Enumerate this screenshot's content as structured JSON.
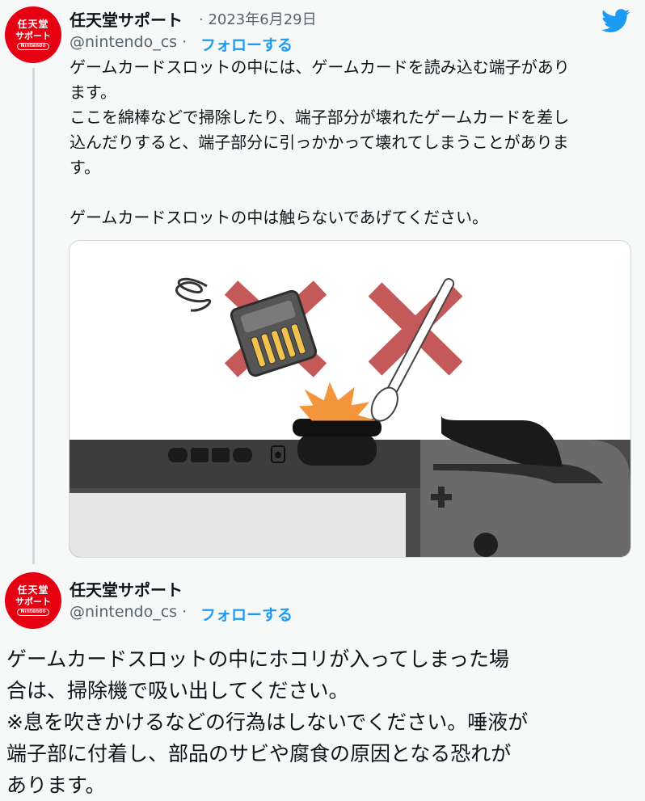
{
  "tweet1": {
    "avatar": {
      "line1": "任天堂",
      "line2": "サポート",
      "line3": "Nintendo"
    },
    "name": "任天堂サポート",
    "date": "· 2023年6月29日",
    "handle": "@nintendo_cs ·",
    "follow": "フォローする",
    "text": "ゲームカードスロットの中には、ゲームカードを読み込む端子があり\nます。\nここを綿棒などで掃除したり、端子部分が壊れたゲームカードを差し\n込んだりすると、端子部分に引っかかって壊れてしまうことがありま\nす。\n\nゲームカードスロットの中は触らないであげてください。"
  },
  "tweet2": {
    "avatar": {
      "line1": "任天堂",
      "line2": "サポート",
      "line3": "Nintendo"
    },
    "name": "任天堂サポート",
    "handle": "@nintendo_cs ·",
    "follow": "フォローする",
    "text": "ゲームカードスロットの中にホコリが入ってしまった場\n合は、掃除機で吸い出してください。\n※息を吹きかけるなどの行為はしないでください。唾液が\n端子部に付着し、部品のサビや腐食の原因となる恐れが\nあります。"
  },
  "colors": {
    "accent": "#1d9bf0",
    "brand": "#e60012",
    "cross": "#c4595a"
  }
}
